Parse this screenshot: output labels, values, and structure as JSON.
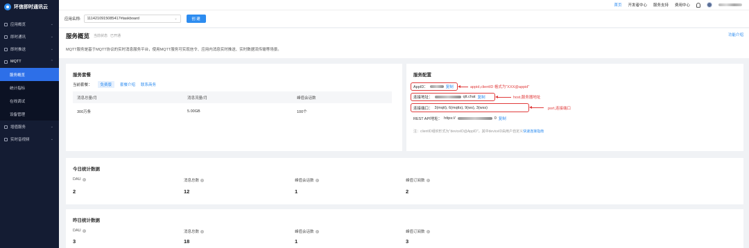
{
  "brand": {
    "name": "环信即时通讯云"
  },
  "sidebar": {
    "items": [
      {
        "label": "应用概览",
        "icon": "grid-icon"
      },
      {
        "label": "即时通讯",
        "icon": "chat-icon"
      },
      {
        "label": "即时推送",
        "icon": "push-icon"
      },
      {
        "label": "MQTT",
        "icon": "mqtt-icon"
      },
      {
        "label": "增值服务",
        "icon": "star-icon"
      },
      {
        "label": "实时音视频",
        "icon": "video-icon"
      }
    ],
    "mqtt_sub": [
      "服务概览",
      "统计指标",
      "在线调试",
      "设备管理"
    ]
  },
  "topbar": {
    "links": [
      "首页",
      "开发者中心",
      "服务支持",
      "费用中心"
    ],
    "active_index": 0
  },
  "appbar": {
    "label": "应用名称:",
    "selected": "1114210915085417#taskboard",
    "create": "创 建"
  },
  "header": {
    "title": "服务概览",
    "status_label": "当前状态",
    "status_value": "已开通",
    "help_link": "功能介绍",
    "intro": "MQTT服务是基于MQTT协议的实时消息服务平台，使用MQTT服务可实现信令、应用内消息实时推送、实时数据流传输等场景。"
  },
  "package": {
    "title": "服务套餐",
    "current_label": "当前套餐：",
    "current_value": "免费版",
    "links": [
      "套餐介绍",
      "联系商务"
    ],
    "headers": [
      "消息总量/月",
      "消息流量/月",
      "峰值会话数"
    ],
    "values": [
      "300万条",
      "5.00GB",
      "100个"
    ]
  },
  "config": {
    "title": "服务配置",
    "appid_label": "AppID：",
    "copy": "复制",
    "host_label": "连接地址：",
    "host_suffix": "qtt.chat",
    "port_label": "连接端口：",
    "ports": "3(mqtt), 6(mqtts), 9(ws), 3(wss)",
    "rest_label": "REST API地址：",
    "rest_prefix": "https://",
    "rest_suffix": "0",
    "note": "注：clientID组织形式为\"deviceID@AppID\"，其中deviceID由用户自定义",
    "note_link": "快速连接指南"
  },
  "annotations": {
    "appid": "appid,clientID 格式为\"XXX@appid\"",
    "host": "host,服务器地址",
    "port": "port,连接端口"
  },
  "today": {
    "title": "今日统计数据",
    "labels": [
      "DAU",
      "消息总数",
      "峰值会话数",
      "峰值订阅数"
    ],
    "values": [
      "2",
      "12",
      "1",
      "2"
    ]
  },
  "yesterday": {
    "title": "昨日统计数据",
    "labels": [
      "DAU",
      "消息总数",
      "峰值会话数",
      "峰值订阅数"
    ],
    "values": [
      "3",
      "18",
      "1",
      "3"
    ]
  },
  "colors": {
    "accent": "#2d8cf0",
    "sidebar": "#141c33",
    "annotation": "#e03a3a"
  }
}
